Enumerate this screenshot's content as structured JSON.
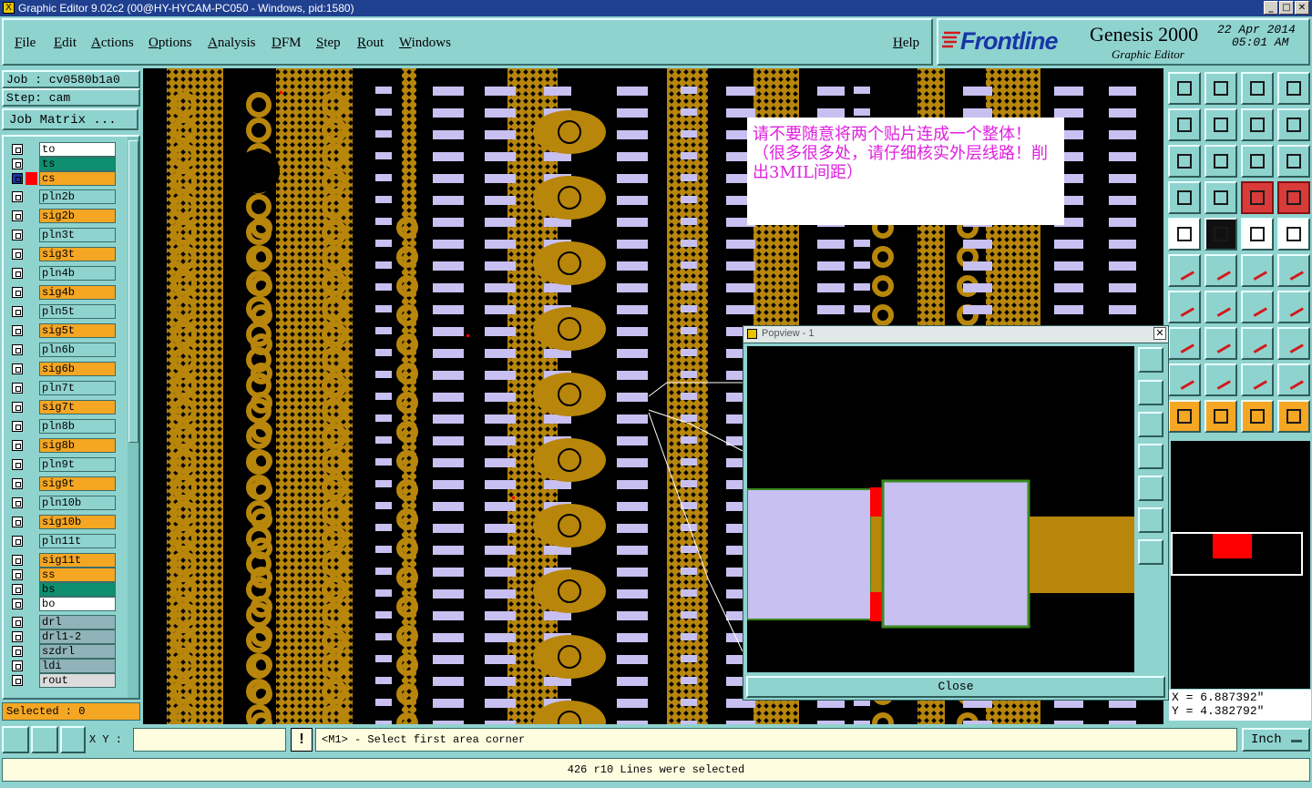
{
  "window": {
    "title": "Graphic Editor 9.02c2 (00@HY-HYCAM-PC050 - Windows, pid:1580)"
  },
  "menu": [
    "File",
    "Edit",
    "Actions",
    "Options",
    "Analysis",
    "DFM",
    "Step",
    "Rout",
    "Windows"
  ],
  "help_label": "Help",
  "brand": {
    "logo": "Frontline",
    "product": "Genesis 2000",
    "subtitle": "Graphic Editor",
    "date": "22 Apr 2014",
    "time": "05:01 AM"
  },
  "job": {
    "job_label": "Job : cv0580b1a0",
    "step_label": "Step: cam",
    "matrix_button": "Job Matrix ..."
  },
  "layers": [
    {
      "name": "to",
      "color": "#ffffff"
    },
    {
      "name": "ts",
      "color": "#0f8f6f"
    },
    {
      "name": "cs",
      "color": "#f5a623"
    },
    {
      "name": "pln2b",
      "color": "#8fd3cf"
    },
    {
      "name": "sig2b",
      "color": "#f5a623"
    },
    {
      "name": "pln3t",
      "color": "#8fd3cf"
    },
    {
      "name": "sig3t",
      "color": "#f5a623"
    },
    {
      "name": "pln4b",
      "color": "#8fd3cf"
    },
    {
      "name": "sig4b",
      "color": "#f5a623"
    },
    {
      "name": "pln5t",
      "color": "#8fd3cf"
    },
    {
      "name": "sig5t",
      "color": "#f5a623"
    },
    {
      "name": "pln6b",
      "color": "#8fd3cf"
    },
    {
      "name": "sig6b",
      "color": "#f5a623"
    },
    {
      "name": "pln7t",
      "color": "#8fd3cf"
    },
    {
      "name": "sig7t",
      "color": "#f5a623"
    },
    {
      "name": "pln8b",
      "color": "#8fd3cf"
    },
    {
      "name": "sig8b",
      "color": "#f5a623"
    },
    {
      "name": "pln9t",
      "color": "#8fd3cf"
    },
    {
      "name": "sig9t",
      "color": "#f5a623"
    },
    {
      "name": "pln10b",
      "color": "#8fd3cf"
    },
    {
      "name": "sig10b",
      "color": "#f5a623"
    },
    {
      "name": "pln11t",
      "color": "#8fd3cf"
    },
    {
      "name": "sig11t",
      "color": "#f5a623"
    },
    {
      "name": "ss",
      "color": "#f5a623"
    },
    {
      "name": "bs",
      "color": "#0f8f6f"
    },
    {
      "name": "bo",
      "color": "#ffffff"
    },
    {
      "name": "drl",
      "color": "#8fb3b8"
    },
    {
      "name": "drl1-2",
      "color": "#8fb3b8"
    },
    {
      "name": "szdrl",
      "color": "#8fb3b8"
    },
    {
      "name": "ldi",
      "color": "#8fb3b8"
    },
    {
      "name": "rout",
      "color": "#dcdcdc"
    }
  ],
  "selected_label": "Selected : 0",
  "note_text": "请不要随意将两个贴片连成一个整体！（很多很多处，请仔细核实外层线路！削出3MIL间距）",
  "popview": {
    "title": "Popview - 1",
    "close_label": "Close"
  },
  "coords": {
    "x": "X = 6.887392\"",
    "y": "Y = 4.382792\""
  },
  "status": {
    "xy_label": "X Y :",
    "xy_value": "",
    "prompt": "<M1> - Select first area corner",
    "unit": "Inch",
    "message": "426 r10 Lines were selected"
  },
  "colors": {
    "copper": "#b8860b",
    "pad": "#c8c0f0",
    "background": "#000000",
    "accent": "#ff0000"
  }
}
